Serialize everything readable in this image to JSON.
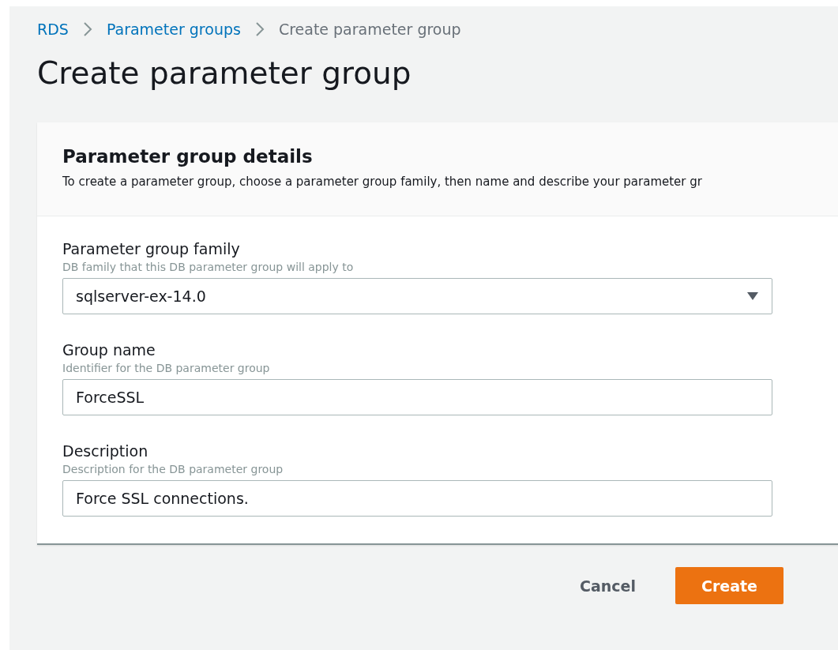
{
  "breadcrumb": [
    {
      "label": "RDS",
      "link": true
    },
    {
      "label": "Parameter groups",
      "link": true
    },
    {
      "label": "Create parameter group",
      "link": false
    }
  ],
  "title": "Create parameter group",
  "panel": {
    "title": "Parameter group details",
    "description": "To create a parameter group, choose a parameter group family, then name and describe your parameter gr",
    "fields": [
      {
        "kind": "select",
        "label": "Parameter group family",
        "hint": "DB family that this DB parameter group will apply to",
        "value": "sqlserver-ex-14.0"
      },
      {
        "kind": "text",
        "label": "Group name",
        "hint": "Identifier for the DB parameter group",
        "value": "ForceSSL"
      },
      {
        "kind": "text",
        "label": "Description",
        "hint": "Description for the DB parameter group",
        "value": "Force SSL connections."
      }
    ]
  },
  "buttons": [
    {
      "label": "Cancel",
      "kind": "link"
    },
    {
      "label": "Create",
      "kind": "primary"
    }
  ]
}
